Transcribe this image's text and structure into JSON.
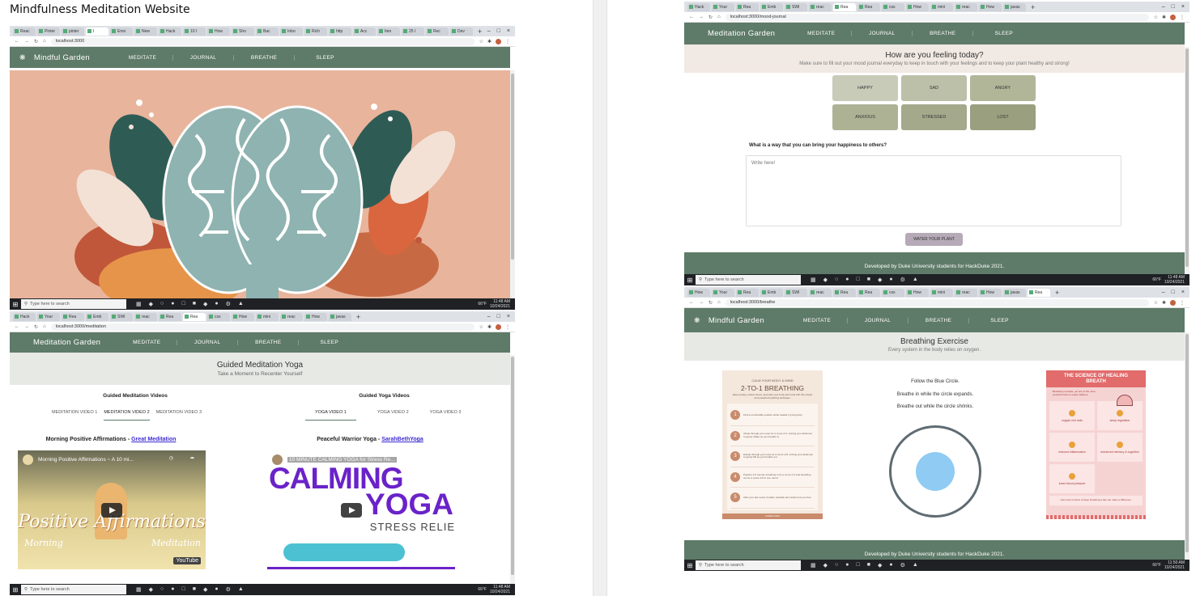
{
  "page_title": "Mindfulness Meditation Website",
  "brand_garden": "Meditation Garden",
  "brand_mindful": "Mindful Garden",
  "nav": [
    "MEDITATE",
    "JOURNAL",
    "BREATHE",
    "SLEEP"
  ],
  "footer_text": "Developed by Duke University students for HackDuke 2021.",
  "taskbar": {
    "search_placeholder": "Type here to search",
    "temp": "66°F",
    "date": "10/24/2021",
    "time_home": "11:48 AM",
    "time_meditate": "11:48 AM",
    "time_journal": "11:48 AM",
    "time_breathe": "11:50 AM"
  },
  "urls": {
    "home": "localhost:3000",
    "meditation": "localhost:3000/meditation",
    "journal": "localhost:3000/mood-journal",
    "breathe": "localhost:3000/breathe"
  },
  "tabs_home": [
    "Reac",
    "Pinter",
    "pinter",
    "I",
    "Emo",
    "New",
    "Hack",
    "10 I",
    "How",
    "Sho",
    "Bac",
    "Inbo",
    "Rich",
    "http",
    "Acc",
    "Iten",
    "25 I",
    "Rec",
    "Dev"
  ],
  "tabs_meditate": [
    "Hack",
    "Your",
    "Rea",
    "Emb",
    "SWI",
    "reac",
    "Rea",
    "Rea",
    "css",
    "How",
    "mini",
    "reac",
    "How",
    "javas"
  ],
  "tabs_journal": [
    "Hack",
    "Your",
    "Rea",
    "Emb",
    "SWI",
    "reac",
    "Rea",
    "Rea",
    "css",
    "How",
    "mini",
    "reac",
    "How",
    "javas"
  ],
  "tabs_breathe": [
    "How",
    "Your",
    "Rea",
    "Emb",
    "SWI",
    "reac",
    "Rea",
    "Rea",
    "css",
    "How",
    "mini",
    "reac",
    "How",
    "javas",
    "Rea"
  ],
  "meditation": {
    "title": "Guided Meditation Yoga",
    "subtitle": "Take a Moment to Recenter Yourself",
    "left_heading": "Guided Meditation Videos",
    "right_heading": "Guided Yoga Videos",
    "left_tabs": [
      "MEDITATION VIDEO 1",
      "MEDITATION VIDEO 2",
      "MEDITATION VIDEO 3"
    ],
    "right_tabs": [
      "YOGA VIDEO 1",
      "YOGA VIDEO 2",
      "YOGA VIDEO 3"
    ],
    "left_video_title": "Morning Positive Affirmations - ",
    "left_video_link": "Great Meditation",
    "right_video_title": "Peaceful Warrior Yoga - ",
    "right_video_link": "SarahBethYoga",
    "left_thumb_caption": "Morning Positive Affirmations ~ A 10 mi...",
    "left_thumb_big": "Positive Affirmations",
    "left_thumb_small_left": "Morning",
    "left_thumb_small_right": "Meditation",
    "youtube": "YouTube",
    "right_thumb_caption": "10 MINUTE CALMING YOGA for Stress Re...",
    "right_thumb_big1": "CALMING",
    "right_thumb_big2": "YOGA",
    "right_thumb_sub": "STRESS RELIE",
    "watch_later": "Watch later",
    "share": "Share"
  },
  "journal": {
    "title": "How are you feeling today?",
    "subtitle": "Make sure to fill out your mood journal everyday to keep in touch with your feelings and to keep your plant healthy and strong!",
    "moods": [
      "HAPPY",
      "SAD",
      "ANGRY",
      "ANXIOUS",
      "STRESSED",
      "LOST"
    ],
    "mood_colors": [
      "#c8cbb8",
      "#bcc0a8",
      "#b1b699",
      "#adb295",
      "#a3a98a",
      "#9aa07f"
    ],
    "question": "What is a way that you can bring your happiness to others?",
    "placeholder": "Write here!",
    "submit": "WATER YOUR PLANT"
  },
  "breathe": {
    "title": "Breathing Exercise",
    "subtitle": "Every system in the body relies on oxygen.",
    "instructions": [
      "Follow the Blue Circle.",
      "Breathe in while the circle expands.",
      "Breathe out while the circle shrinks."
    ],
    "left_card": {
      "kicker": "CALM YOUR BODY & MIND",
      "title": "2-TO-1 BREATHING",
      "intro": "Ease anxiety, relieve stress, and calm your body and mind with this simple and powerful breathing technique.",
      "steps": [
        "Find a comfortable position either seated or lying down.",
        "Inhale through your nose for a count of 4, inviting your abdomen to gently inflate as you breathe in.",
        "Exhale through your nose for a count of 8, inviting your abdomen to gently fall as you breathe out.",
        "Practice 3-5 rounds, breathing in for a count of 4 and breathing out for a count of 8 in one round.",
        "After your last round, breathe naturally and notice how you feel."
      ],
      "footer": "GAIAM.COM"
    },
    "right_card": {
      "title": "THE SCIENCE OF HEALING BREATH",
      "intro": "Breathing is simple, yet one of the most powerful tools to restore balance.",
      "tiles": [
        "oxygen rich cells",
        "sleep regulation",
        "reduced inflammation",
        "enhanced memory & cognition",
        "lower blood pressure"
      ],
      "footer_note": "Just a few minutes of deep breathing a day can make a difference."
    }
  }
}
